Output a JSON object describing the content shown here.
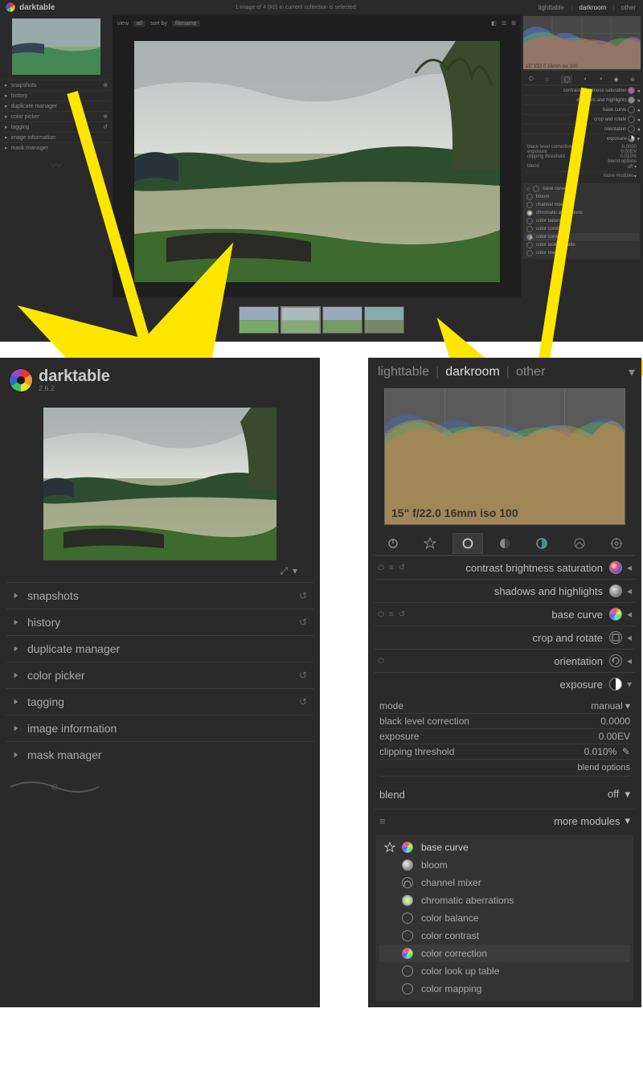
{
  "app": {
    "name": "darktable",
    "version": "2.6.2"
  },
  "views": {
    "lighttable": "lighttable",
    "darkroom": "darkroom",
    "other": "other"
  },
  "top": {
    "status": "1 image of 4 (#2) in current collection is selected",
    "view_lbl": "view",
    "view_val": "all",
    "sort_lbl": "sort by",
    "sort_val": "filename"
  },
  "left_panels": [
    {
      "label": "snapshots"
    },
    {
      "label": "history"
    },
    {
      "label": "duplicate manager"
    },
    {
      "label": "color picker"
    },
    {
      "label": "tagging"
    },
    {
      "label": "image information"
    },
    {
      "label": "mask manager"
    }
  ],
  "histogram": {
    "exif": "15\" f/22.0 16mm iso 100"
  },
  "module_groups": [
    "power",
    "favorites",
    "active",
    "basic",
    "tone",
    "color",
    "correct",
    "effect"
  ],
  "modules": [
    {
      "name": "contrast brightness saturation",
      "enabled": true
    },
    {
      "name": "shadows and highlights",
      "enabled": true
    },
    {
      "name": "base curve",
      "enabled": true
    },
    {
      "name": "crop and rotate",
      "enabled": false
    },
    {
      "name": "orientation",
      "enabled": true
    },
    {
      "name": "exposure",
      "enabled": true,
      "expanded": true
    }
  ],
  "exposure": {
    "mode_label": "mode",
    "mode_value": "manual",
    "black_label": "black level correction",
    "black_value": "0.0000",
    "exp_label": "exposure",
    "exp_value": "0.00EV",
    "clip_label": "clipping threshold",
    "clip_value": "0.010%",
    "blend_options": "blend options",
    "blend_label": "blend",
    "blend_value": "off"
  },
  "more_modules_label": "more modules",
  "more_modules": [
    {
      "name": "base curve",
      "fav": true
    },
    {
      "name": "bloom"
    },
    {
      "name": "channel mixer"
    },
    {
      "name": "chromatic aberrations"
    },
    {
      "name": "color balance"
    },
    {
      "name": "color contrast"
    },
    {
      "name": "color correction",
      "hl": true
    },
    {
      "name": "color look up table"
    },
    {
      "name": "color mapping"
    }
  ]
}
